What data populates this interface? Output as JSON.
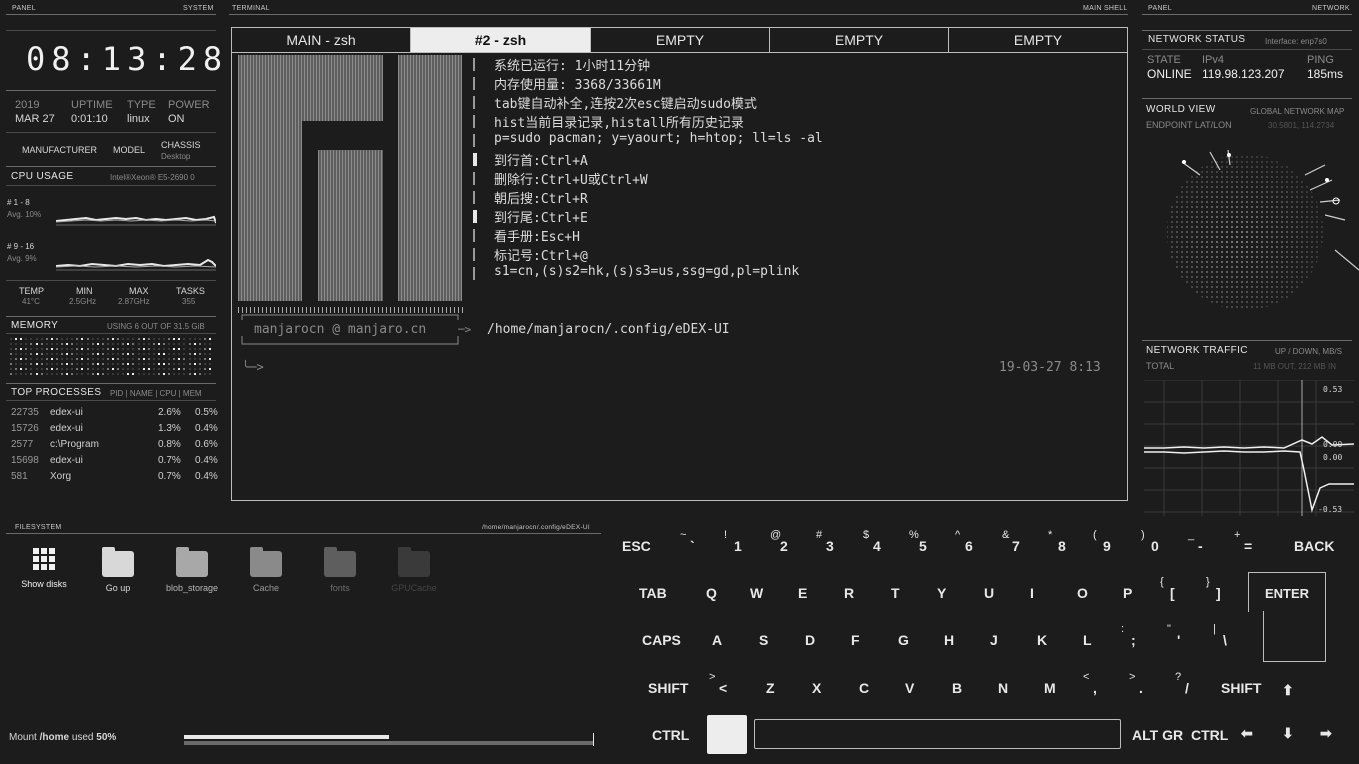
{
  "left_panel": {
    "header_left": "PANEL",
    "header_right": "SYSTEM",
    "clock": "08:13:28",
    "year": "2019",
    "date": "MAR 27",
    "uptime_label": "UPTIME",
    "uptime": "0:01:10",
    "type_label": "TYPE",
    "type": "linux",
    "power_label": "POWER",
    "power": "ON",
    "manufacturer_label": "MANUFACTURER",
    "model_label": "MODEL",
    "chassis_label": "CHASSIS",
    "chassis": "Desktop",
    "cpu_title": "CPU USAGE",
    "cpu_model": "Intel®Xeon® E5-2690 0",
    "cpu_group1_label": "# 1 - 8",
    "cpu_group1_avg": "Avg. 10%",
    "cpu_group2_label": "# 9 - 16",
    "cpu_group2_avg": "Avg. 9%",
    "temp_label": "TEMP",
    "temp": "41°C",
    "min_label": "MIN",
    "min": "2.5GHz",
    "max_label": "MAX",
    "max": "2.87GHz",
    "tasks_label": "TASKS",
    "tasks": "355",
    "memory_title": "MEMORY",
    "memory_usage": "USING 6 OUT OF 31.5 GiB",
    "top_title": "TOP PROCESSES",
    "top_cols": "PID | NAME | CPU | MEM",
    "processes": [
      {
        "pid": "22735",
        "name": "edex-ui",
        "cpu": "2.6%",
        "mem": "0.5%"
      },
      {
        "pid": "15726",
        "name": "edex-ui",
        "cpu": "1.3%",
        "mem": "0.4%"
      },
      {
        "pid": "2577",
        "name": "c:\\Program",
        "cpu": "0.8%",
        "mem": "0.6%"
      },
      {
        "pid": "15698",
        "name": "edex-ui",
        "cpu": "0.7%",
        "mem": "0.4%"
      },
      {
        "pid": "581",
        "name": "Xorg",
        "cpu": "0.7%",
        "mem": "0.4%"
      }
    ]
  },
  "terminal": {
    "header_left": "TERMINAL",
    "header_right": "MAIN SHELL",
    "tabs": [
      "MAIN - zsh",
      "#2 - zsh",
      "EMPTY",
      "EMPTY",
      "EMPTY"
    ],
    "lines": [
      "系统已运行: 1小时11分钟",
      "内存使用量: 3368/33661M",
      "tab键自动补全,连按2次esc键启动sudo模式",
      "hist当前目录记录,histall所有历史记录",
      "p=sudo pacman; y=yaourt; h=htop; ll=ls -al",
      "到行首:Ctrl+A",
      "删除行:Ctrl+U或Ctrl+W",
      "朝后搜:Ctrl+R",
      "到行尾:Ctrl+E",
      "看手册:Esc+H",
      "标记号:Ctrl+@",
      "s1=cn,(s)s2=hk,(s)s3=us,ssg=gd,pl=plink"
    ],
    "user_host": "manjarocn @ manjaro.cn",
    "cwd": "/home/manjarocn/.config/eDEX-UI",
    "timestamp": "19-03-27 8:13",
    "prompt_arrow": "╰─>"
  },
  "right_panel": {
    "header_left": "PANEL",
    "header_right": "NETWORK",
    "net_status_title": "NETWORK STATUS",
    "interface": "Interface: enp7s0",
    "state_label": "STATE",
    "state": "ONLINE",
    "ip_label": "IPv4",
    "ip": "119.98.123.207",
    "ping_label": "PING",
    "ping": "185ms",
    "world_title": "WORLD VIEW",
    "world_sub": "GLOBAL NETWORK MAP",
    "endpoint_label": "ENDPOINT LAT/LON",
    "endpoint": "30.5801, 114.2734",
    "traffic_title": "NETWORK TRAFFIC",
    "traffic_sub": "UP / DOWN, MB/S",
    "total_label": "TOTAL",
    "total": "11 MB OUT, 212 MB IN",
    "chart_ticks": [
      "0.53",
      "0.00",
      "0.00",
      "-0.53"
    ]
  },
  "filesystem": {
    "header_left": "FILESYSTEM",
    "header_right": "/home/manjarocn/.config/eDEX-UI",
    "items": [
      "Show disks",
      "Go up",
      "blob_storage",
      "Cache",
      "fonts",
      "GPUCache"
    ],
    "mount_prefix": "Mount",
    "mount_path": "/home",
    "mount_used_label": "used",
    "mount_used": "50%",
    "usage_fraction": 0.5
  },
  "keyboard": {
    "row1": [
      {
        "sup": "",
        "main": "ESC"
      },
      {
        "sup": "~",
        "main": "`"
      },
      {
        "sup": "!",
        "main": "1"
      },
      {
        "sup": "@",
        "main": "2"
      },
      {
        "sup": "#",
        "main": "3"
      },
      {
        "sup": "$",
        "main": "4"
      },
      {
        "sup": "%",
        "main": "5"
      },
      {
        "sup": "^",
        "main": "6"
      },
      {
        "sup": "&",
        "main": "7"
      },
      {
        "sup": "*",
        "main": "8"
      },
      {
        "sup": "(",
        "main": "9"
      },
      {
        "sup": ")",
        "main": "0"
      },
      {
        "sup": "_",
        "main": "-"
      },
      {
        "sup": "+",
        "main": "="
      },
      {
        "sup": "",
        "main": "BACK"
      }
    ],
    "row2": [
      "TAB",
      "Q",
      "W",
      "E",
      "R",
      "T",
      "Y",
      "U",
      "I",
      "O",
      "P"
    ],
    "row2_brackets": [
      {
        "sup": "{",
        "main": "["
      },
      {
        "sup": "}",
        "main": "]"
      }
    ],
    "enter": "ENTER",
    "row3": [
      "CAPS",
      "A",
      "S",
      "D",
      "F",
      "G",
      "H",
      "J",
      "K",
      "L"
    ],
    "row3_extra": [
      {
        "sup": ":",
        "main": ";"
      },
      {
        "sup": "\"",
        "main": "'"
      },
      {
        "sup": "|",
        "main": "\\"
      }
    ],
    "row4": [
      "SHIFT",
      "Z",
      "X",
      "C",
      "V",
      "B",
      "N",
      "M"
    ],
    "row4_lt": {
      "sup": ">",
      "main": "<"
    },
    "row4_extra": [
      {
        "sup": "<",
        "main": ","
      },
      {
        "sup": ">",
        "main": "."
      },
      {
        "sup": "?",
        "main": "/"
      }
    ],
    "shift_right": "SHIFT",
    "ctrl": "CTRL",
    "altgr": "ALT GR",
    "ctrl_right": "CTRL",
    "arrows": [
      "⬆",
      "⬅",
      "⬇",
      "➡"
    ]
  }
}
